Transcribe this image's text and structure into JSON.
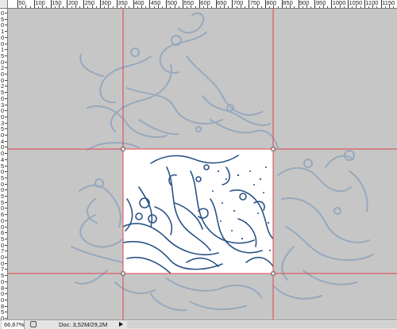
{
  "rulers": {
    "top_labels": [
      "50",
      "100",
      "150",
      "200",
      "250",
      "300",
      "350",
      "400",
      "450",
      "500",
      "550",
      "600",
      "650",
      "700",
      "750",
      "800",
      "850",
      "900",
      "950",
      "1000",
      "1050",
      "1100",
      "1150"
    ],
    "left_labels": [
      "0",
      "5",
      "0",
      "1",
      "0",
      "0",
      "1",
      "5",
      "0",
      "2",
      "0",
      "0",
      "2",
      "5",
      "0",
      "3",
      "0",
      "0",
      "3",
      "5",
      "0",
      "4",
      "0",
      "0",
      "4",
      "5",
      "0",
      "5",
      "0",
      "0",
      "5",
      "5",
      "0",
      "6",
      "0",
      "0",
      "6",
      "5",
      "0",
      "7",
      "0",
      "0",
      "7",
      "5",
      "0",
      "8",
      "0",
      "0",
      "8",
      "5",
      "0"
    ]
  },
  "status_bar": {
    "zoom": "66,67%",
    "doc_size": "Doc: 3,52M/29,2M"
  },
  "colors": {
    "canvas_bg": "#c6c6c6",
    "guide": "#e0404a",
    "ink": "#2a5385",
    "faded_ink": "#8fa5bc",
    "selection_bg": "#ffffff"
  },
  "icons": [
    "hand-tool-icon",
    "status-menu-arrow-icon"
  ]
}
